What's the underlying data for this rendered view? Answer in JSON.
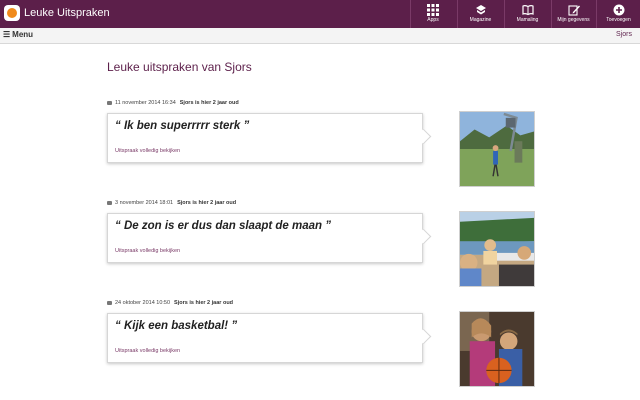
{
  "app": {
    "title": "Leuke Uitspraken",
    "logo_icon": "app-logo-icon"
  },
  "nav": [
    {
      "label": "Apps",
      "icon": "apps-grid-icon"
    },
    {
      "label": "Magazine",
      "icon": "magazine-icon"
    },
    {
      "label": "Mamaling",
      "icon": "book-icon"
    },
    {
      "label": "Mijn gegevens",
      "icon": "edit-icon"
    },
    {
      "label": "Toevoegen",
      "icon": "add-icon"
    }
  ],
  "menubar": {
    "menu_label": "Menu",
    "user": "Sjors"
  },
  "page": {
    "title": "Leuke uitspraken van Sjors"
  },
  "entries": [
    {
      "date": "11 november 2014 16:34",
      "age": "Sjors is hier 2 jaar oud",
      "quote": "“ Ik ben superrrrr sterk ”",
      "link": "Uitspraak volledig bekijken"
    },
    {
      "date": "3 november 2014 18:01",
      "age": "Sjors is hier 2 jaar oud",
      "quote": "“ De zon is er dus dan slaapt de maan ”",
      "link": "Uitspraak volledig bekijken"
    },
    {
      "date": "24 oktober 2014 10:50",
      "age": "Sjors is hier 2 jaar oud",
      "quote": "“ Kijk een basketbal! ”",
      "link": "Uitspraak volledig bekijken"
    }
  ],
  "colors": {
    "brand": "#5c1f4a",
    "accent_orange": "#f08a1c",
    "link": "#7a3a67"
  }
}
